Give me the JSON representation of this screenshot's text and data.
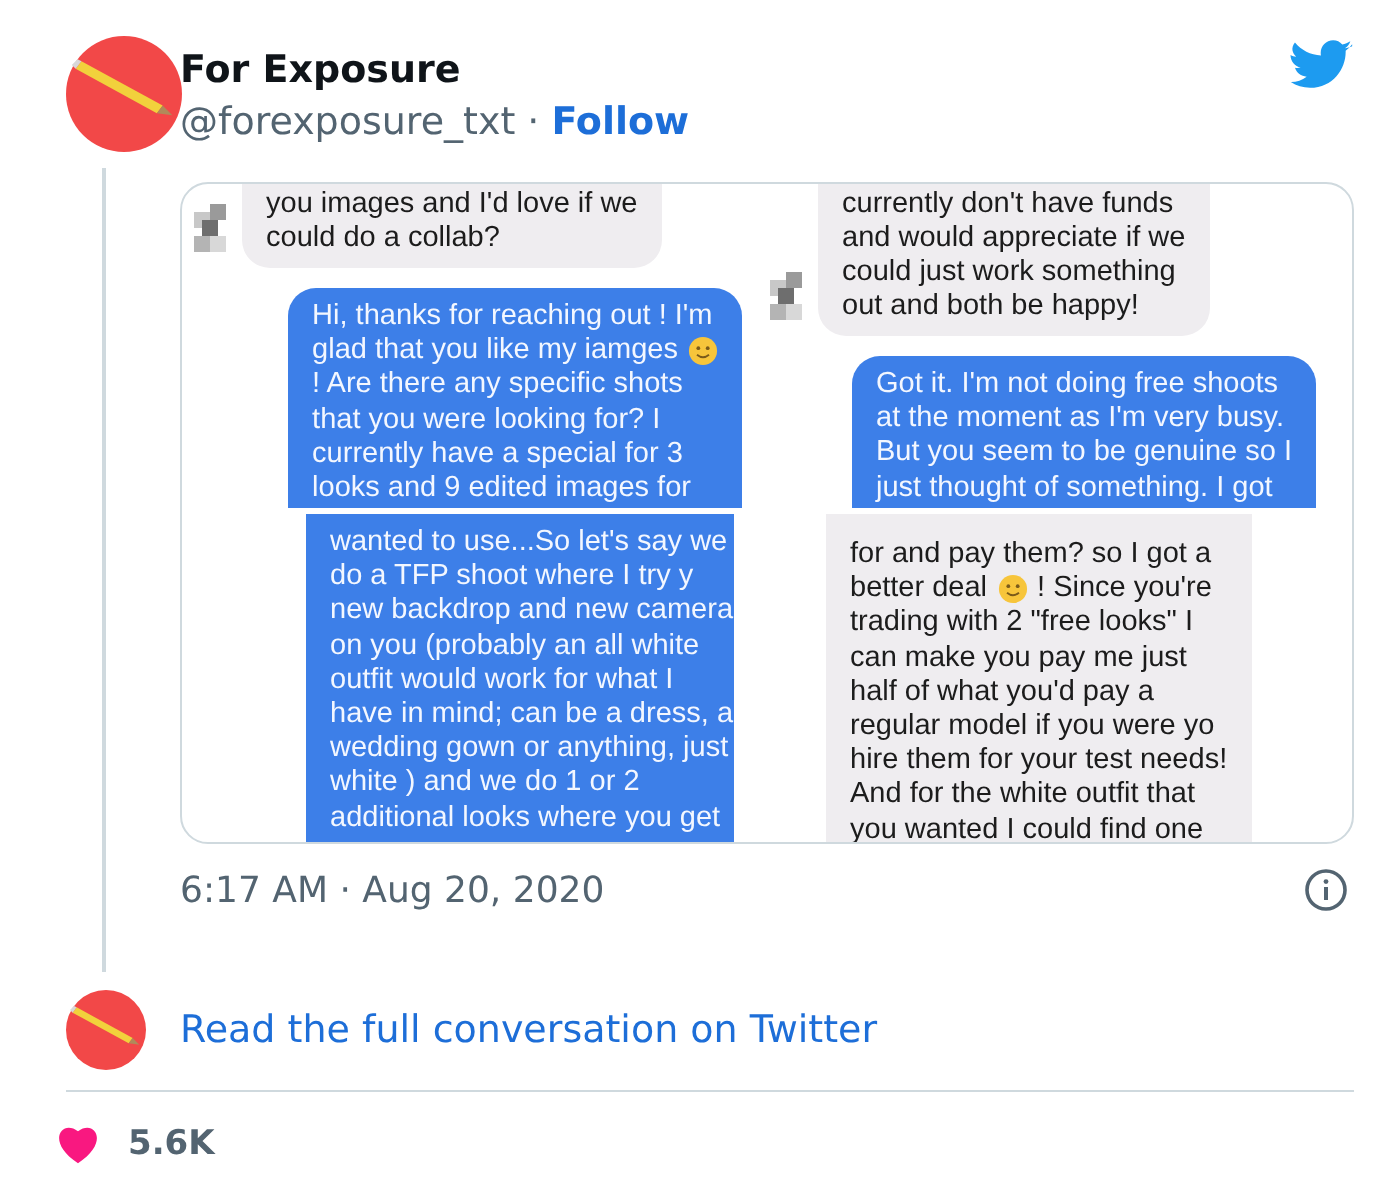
{
  "tweet": {
    "author": {
      "name": "For Exposure",
      "handle": "@forexposure_txt",
      "separator": "·",
      "follow": "Follow"
    },
    "media": {
      "panels": [
        {
          "messages": [
            {
              "kind": "received",
              "avatar": true,
              "lines": [
                {
                  "text": "you images and I'd love if we"
                },
                {
                  "text": "could do a collab?"
                }
              ]
            },
            {
              "kind": "sent",
              "avatar": false,
              "lines": [
                {
                  "text": "Hi, thanks for reaching out ! I'm"
                },
                {
                  "text": "glad that you like my iamges",
                  "emoji": true
                },
                {
                  "text": "! Are there any specific shots"
                },
                {
                  "text": "that you were looking for? I"
                },
                {
                  "text": "currently have a special for 3"
                },
                {
                  "text": "looks and 9 edited images for"
                }
              ]
            }
          ]
        },
        {
          "messages": [
            {
              "kind": "received",
              "avatar": true,
              "lines": [
                {
                  "text": "currently don't have funds"
                },
                {
                  "text": "and would appreciate if we"
                },
                {
                  "text": "could just work something"
                },
                {
                  "text": "out and both be happy!"
                }
              ]
            },
            {
              "kind": "sent",
              "avatar": false,
              "lines": [
                {
                  "text": "Got it. I'm not doing free shoots"
                },
                {
                  "text": "at the moment as I'm very busy."
                },
                {
                  "text": "But you seem to be genuine so I"
                },
                {
                  "text": "just thought of something. I got"
                }
              ]
            }
          ]
        },
        {
          "messages": [
            {
              "kind": "sent",
              "avatar": false,
              "lines": [
                {
                  "text": "wanted to use...So let's say we"
                },
                {
                  "text": "do a TFP shoot where I try y"
                },
                {
                  "text": "new backdrop and new camera"
                },
                {
                  "text": "on you (probably an all white"
                },
                {
                  "text": "outfit would work for what I"
                },
                {
                  "text": "have in mind; can be a dress, a"
                },
                {
                  "text": "wedding gown or anything, just"
                },
                {
                  "text": "white ) and we do 1 or 2"
                },
                {
                  "text": "additional looks where you get"
                }
              ]
            }
          ]
        },
        {
          "messages": [
            {
              "kind": "received",
              "avatar": false,
              "lines": [
                {
                  "text": "for and pay them? so I got a"
                },
                {
                  "text": "better deal",
                  "emoji": true,
                  "after": "! Since you're"
                },
                {
                  "text": "trading with 2 \"free looks\" I"
                },
                {
                  "text": "can make you pay me just"
                },
                {
                  "text": "half of what you'd pay a"
                },
                {
                  "text": "regular model if you were yo"
                },
                {
                  "text": "hire them for your test needs!"
                },
                {
                  "text": "And for the white outfit that"
                },
                {
                  "text": "you wanted I could find one"
                }
              ]
            }
          ]
        }
      ]
    },
    "timestamp": "6:17 AM · Aug 20, 2020",
    "reply_link": "Read the full conversation on Twitter",
    "likes": "5.6K"
  }
}
